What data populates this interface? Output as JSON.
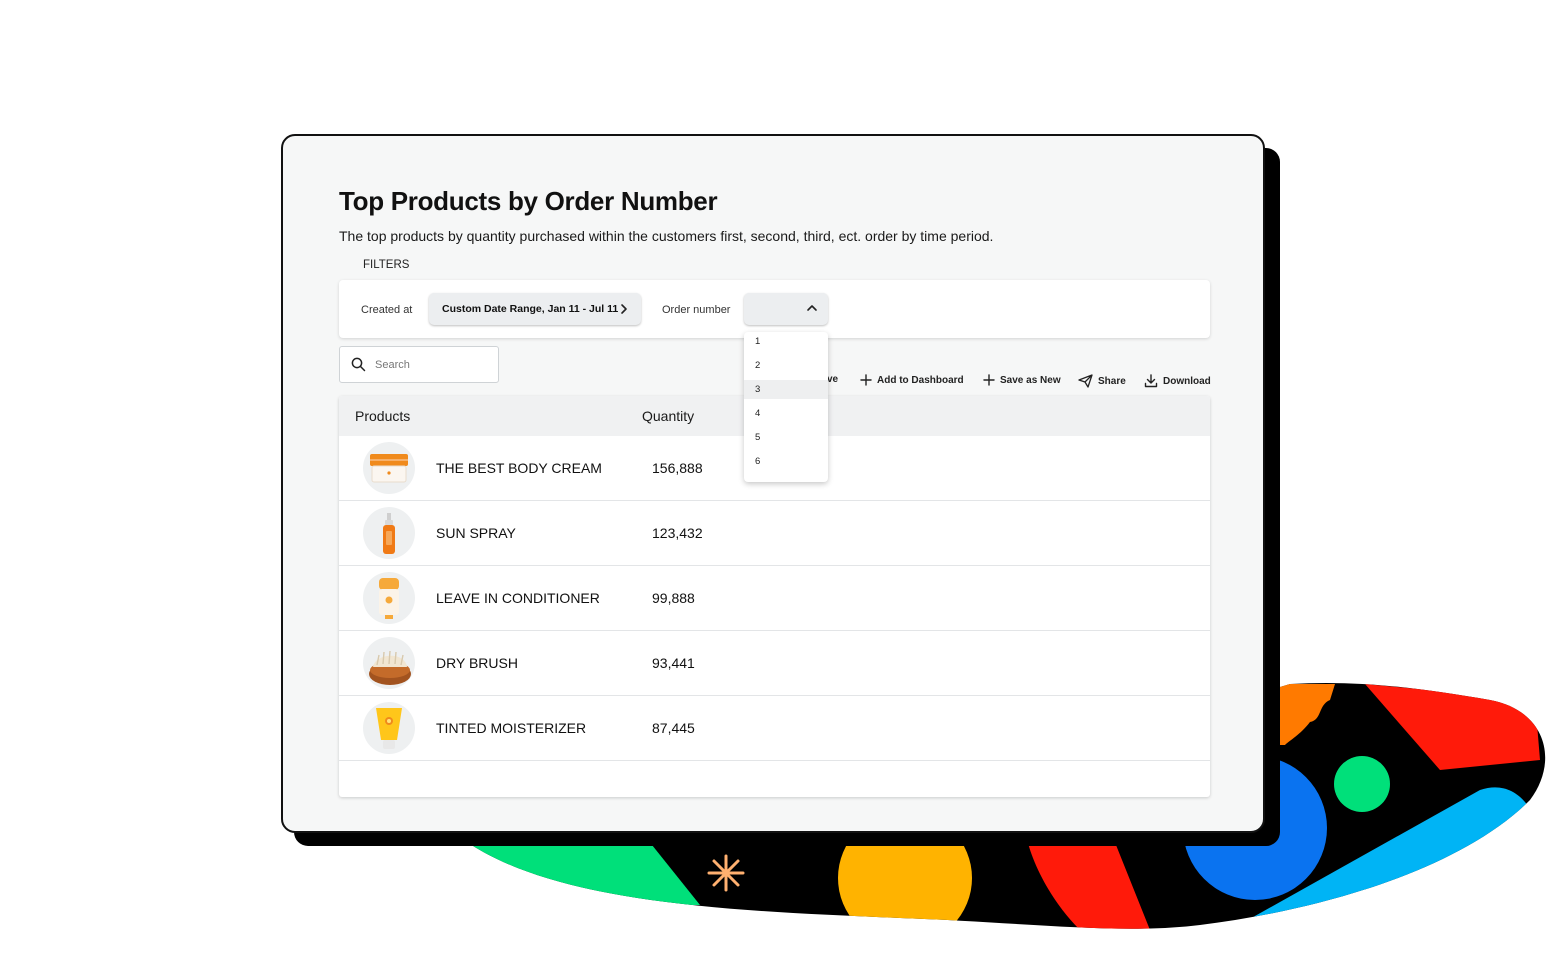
{
  "report": {
    "title": "Top Products by Order Number",
    "subtitle": "The top products by quantity purchased within the customers first, second, third, ect. order by time period."
  },
  "filters": {
    "section_label": "FILTERS",
    "created_at_label": "Created at",
    "date_range_value": "Custom Date Range, Jan 11 - Jul 11",
    "order_number_label": "Order number",
    "order_number_value": "",
    "order_number_options": [
      "1",
      "2",
      "3",
      "4",
      "5",
      "6"
    ],
    "order_number_highlighted": "3"
  },
  "search": {
    "placeholder": "Search"
  },
  "toolbar": {
    "save_partial": "ve",
    "add_to_dashboard": "Add to Dashboard",
    "save_as_new": "Save as New",
    "share": "Share",
    "download": "Download"
  },
  "table": {
    "columns": [
      "Products",
      "Quantity"
    ],
    "rows": [
      {
        "product": "THE BEST BODY CREAM",
        "quantity": "156,888",
        "icon": "body-cream-jar-icon"
      },
      {
        "product": "SUN SPRAY",
        "quantity": "123,432",
        "icon": "sun-spray-bottle-icon"
      },
      {
        "product": "LEAVE IN CONDITIONER",
        "quantity": "99,888",
        "icon": "conditioner-bottle-icon"
      },
      {
        "product": "DRY BRUSH",
        "quantity": "93,441",
        "icon": "dry-brush-icon"
      },
      {
        "product": "TINTED MOISTERIZER",
        "quantity": "87,445",
        "icon": "moisturizer-tube-icon"
      }
    ]
  },
  "colors": {
    "card_border": "#111111",
    "card_bg": "#f6f7f7",
    "header_row_bg": "#f0f1f2",
    "product_orange": "#f08a1c",
    "blob_black": "#000000",
    "blob_green": "#00e07a",
    "blob_yellow": "#ffb300",
    "blob_red": "#ff1a0a",
    "blob_blue": "#0a73f0",
    "blob_cyan": "#00b4f5",
    "blob_orange": "#ff7a00"
  }
}
